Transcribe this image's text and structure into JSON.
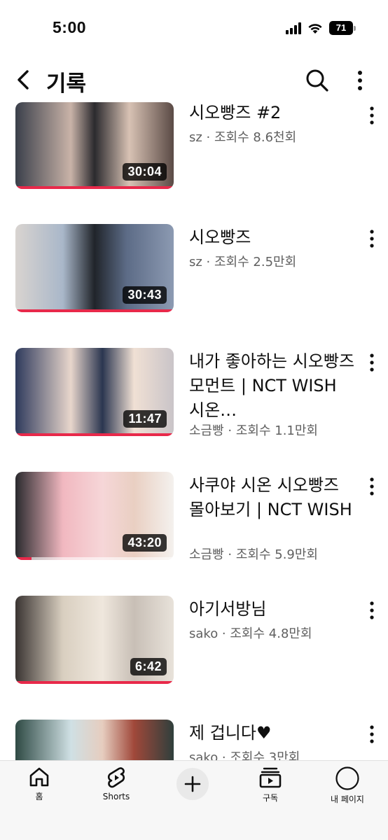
{
  "status_bar": {
    "time": "5:00",
    "battery": "71",
    "icons": [
      "signal-icon",
      "wifi-icon",
      "battery-icon"
    ]
  },
  "header": {
    "title": "기록",
    "icons": [
      "back-icon",
      "search-icon",
      "more-vert-icon"
    ]
  },
  "videos": [
    {
      "title": "시오빵즈 #2",
      "channel": "sz",
      "views": "조회수 8.6천회",
      "meta": "sz · 조회수 8.6천회",
      "duration": "30:04",
      "progress": 1.0
    },
    {
      "title": "시오빵즈",
      "channel": "sz",
      "views": "조회수 2.5만회",
      "meta": "sz · 조회수 2.5만회",
      "duration": "30:43",
      "progress": 1.0
    },
    {
      "title": "내가 좋아하는 시오빵즈 모먼트 | NCT WISH 시온…",
      "channel": "소금빵",
      "views": "조회수 1.1만회",
      "meta": "소금빵 · 조회수 1.1만회",
      "duration": "11:47",
      "progress": 1.0
    },
    {
      "title": "사쿠야 시온 시오빵즈 몰아보기 | NCT WISH",
      "channel": "소금빵",
      "views": "조회수 5.9만회",
      "meta": "소금빵 · 조회수 5.9만회",
      "duration": "43:20",
      "progress": 0.1
    },
    {
      "title": "아기서방님",
      "channel": "sako",
      "views": "조회수 4.8만회",
      "meta": "sako · 조회수 4.8만회",
      "duration": "6:42",
      "progress": 1.0
    },
    {
      "title": "제 겁니다♥",
      "channel": "sako",
      "views": "조회수 3만회",
      "meta": "sako · 조회수 3만회",
      "duration": "",
      "progress": 0
    }
  ],
  "bottom_nav": {
    "home": "홈",
    "shorts": "Shorts",
    "create": "create-icon",
    "subscriptions": "구독",
    "my_page": "내 페이지"
  },
  "colors": {
    "progress": "#e8294a",
    "meta_text": "#606060",
    "nav_bg": "#f7f7f7"
  }
}
